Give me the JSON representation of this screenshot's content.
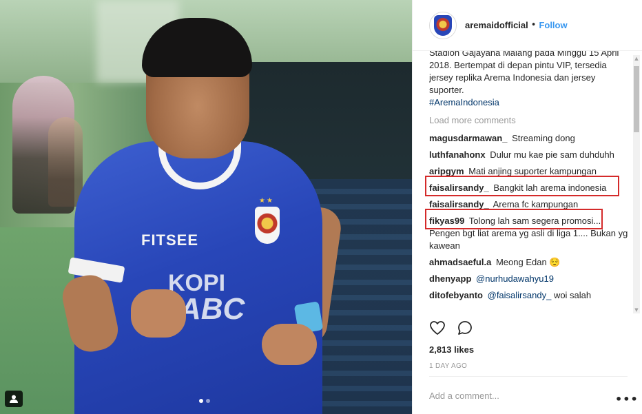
{
  "header": {
    "username": "aremaidofficial",
    "separator": "•",
    "follow_label": "Follow"
  },
  "caption": {
    "text": "Stadion Gajayana Malang pada Minggu 15 April 2018. Bertempat di depan pintu VIP, tersedia jersey replika Arema Indonesia dan jersey suporter.",
    "hashtag": "#AremaIndonesia"
  },
  "load_more_label": "Load more comments",
  "comments": [
    {
      "user": "magusdarmawan_",
      "text": "Streaming dong",
      "mention": ""
    },
    {
      "user": "luthfanahonx",
      "text": "Dulur mu kae pie sam duhduhh",
      "mention": ""
    },
    {
      "user": "aripgym",
      "text": "Mati anjing suporter kampungan",
      "mention": ""
    },
    {
      "user": "faisalirsandy_",
      "text": "Bangkit lah arema indonesia",
      "mention": ""
    },
    {
      "user": "faisalirsandy_",
      "text": "Arema fc kampungan",
      "mention": ""
    },
    {
      "user": "fikyas99",
      "text": "Tolong lah sam segera promosi.... Pengen bgt liat arema yg asli di liga 1.... Bukan yg kawean",
      "mention": ""
    },
    {
      "user": "ahmadsaeful.a",
      "text": "Meong Edan 😌",
      "mention": ""
    },
    {
      "user": "dhenyapp",
      "text": "",
      "mention": "@nurhudawahyu19"
    },
    {
      "user": "ditofebyanto",
      "text": "woi salah",
      "mention": "@faisalirsandy_"
    }
  ],
  "photo": {
    "sponsor_text": "FITSEE",
    "kopi_text": "KOPI",
    "abc_text": "ABC",
    "stars": "★★"
  },
  "likes": "2,813 likes",
  "age": "1 DAY AGO",
  "add_comment_placeholder": "Add a comment...",
  "more_icon": "•••",
  "colors": {
    "link_blue": "#3897f0",
    "hashtag": "#003569",
    "highlight_red": "#d42a2a"
  }
}
